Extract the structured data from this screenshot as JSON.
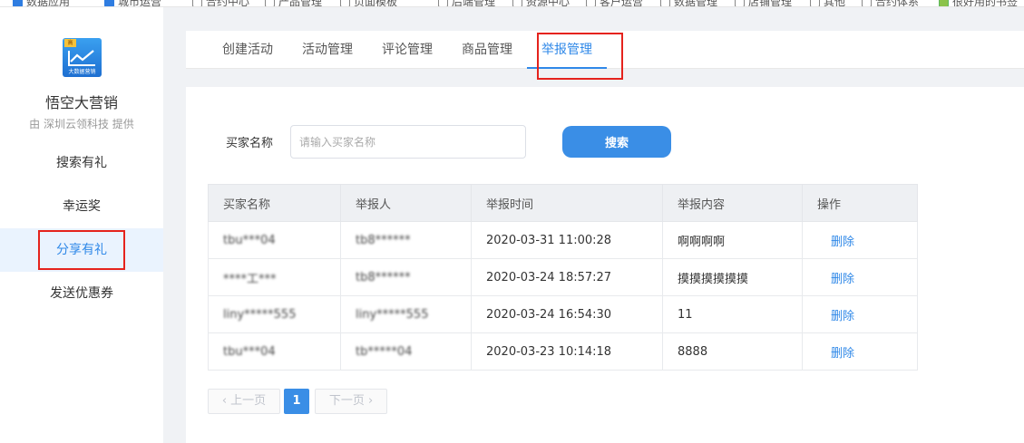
{
  "bookmarks": [
    "数据应用",
    "城市运营",
    "合约中心",
    "产品管理",
    "页面模板",
    "后端管理",
    "资源中心",
    "客户运营",
    "数据管理",
    "店铺管理",
    "其他",
    "合约体系",
    "很好用的书签"
  ],
  "sidebar": {
    "app_name": "悟空大营销",
    "provider": "由 深圳云领科技 提供",
    "logo_text": "大数据营销",
    "logo_tag": "高",
    "items": [
      {
        "label": "搜索有礼"
      },
      {
        "label": "幸运奖"
      },
      {
        "label": "分享有礼"
      },
      {
        "label": "发送优惠券"
      }
    ]
  },
  "tabs": [
    {
      "label": "创建活动"
    },
    {
      "label": "活动管理"
    },
    {
      "label": "评论管理"
    },
    {
      "label": "商品管理"
    },
    {
      "label": "举报管理"
    }
  ],
  "search": {
    "label": "买家名称",
    "placeholder": "请输入买家名称",
    "button": "搜索"
  },
  "table": {
    "columns": [
      "买家名称",
      "举报人",
      "举报时间",
      "举报内容",
      "操作"
    ],
    "rows": [
      {
        "buyer": "tbu***04",
        "reporter": "tb8******",
        "time": "2020-03-31 11:00:28",
        "content": "啊啊啊啊",
        "action": "删除"
      },
      {
        "buyer": "****工***",
        "reporter": "tb8******",
        "time": "2020-03-24 18:57:27",
        "content": "摸摸摸摸摸摸",
        "action": "删除"
      },
      {
        "buyer": "liny*****555",
        "reporter": "liny*****555",
        "time": "2020-03-24 16:54:30",
        "content": "11",
        "action": "删除"
      },
      {
        "buyer": "tbu***04",
        "reporter": "tb*****04",
        "time": "2020-03-23 10:14:18",
        "content": "8888",
        "action": "删除"
      }
    ]
  },
  "pager": {
    "prev": "上一页",
    "current": "1",
    "next": "下一页"
  },
  "colors": {
    "accent": "#2f88e8",
    "button": "#3a8ee6",
    "highlight_box": "#e5231d"
  }
}
